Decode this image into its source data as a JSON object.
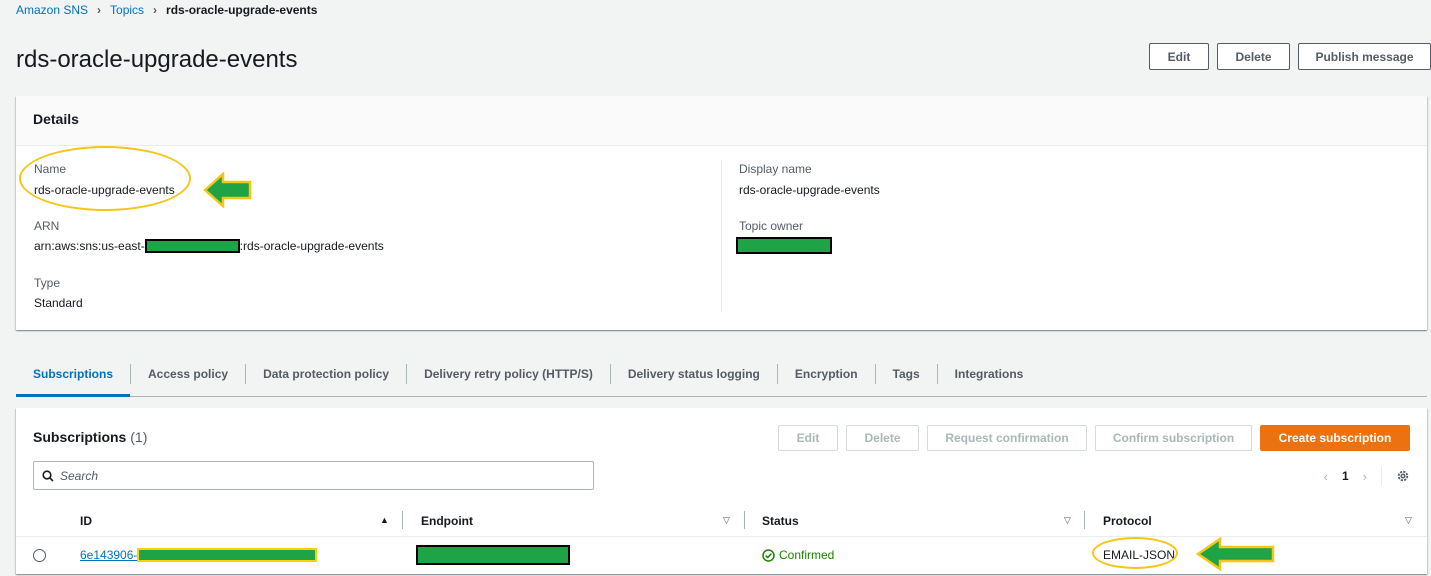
{
  "breadcrumb": {
    "items": [
      "Amazon SNS",
      "Topics"
    ],
    "current": "rds-oracle-upgrade-events"
  },
  "page": {
    "title": "rds-oracle-upgrade-events",
    "actions": {
      "edit": "Edit",
      "delete": "Delete",
      "publish": "Publish message"
    }
  },
  "details": {
    "heading": "Details",
    "name_label": "Name",
    "name_value": "rds-oracle-upgrade-events",
    "arn_label": "ARN",
    "arn_prefix": "arn:aws:sns:us-east-",
    "arn_suffix": ":rds-oracle-upgrade-events",
    "type_label": "Type",
    "type_value": "Standard",
    "display_name_label": "Display name",
    "display_name_value": "rds-oracle-upgrade-events",
    "topic_owner_label": "Topic owner"
  },
  "tabs": [
    "Subscriptions",
    "Access policy",
    "Data protection policy",
    "Delivery retry policy (HTTP/S)",
    "Delivery status logging",
    "Encryption",
    "Tags",
    "Integrations"
  ],
  "subscriptions": {
    "title": "Subscriptions",
    "count": "(1)",
    "actions": {
      "edit": "Edit",
      "delete": "Delete",
      "request_confirmation": "Request confirmation",
      "confirm_subscription": "Confirm subscription",
      "create_subscription": "Create subscription"
    },
    "search_placeholder": "Search",
    "page_number": "1",
    "columns": {
      "id": "ID",
      "endpoint": "Endpoint",
      "status": "Status",
      "protocol": "Protocol"
    },
    "rows": [
      {
        "id_prefix": "6e143906-",
        "status": "Confirmed",
        "protocol": "EMAIL-JSON"
      }
    ]
  },
  "colors": {
    "link": "#0073bb",
    "primary_button": "#ec7211",
    "confirmed": "#1d8102",
    "redaction": "#1ea446",
    "annotation": "#f5c518"
  }
}
